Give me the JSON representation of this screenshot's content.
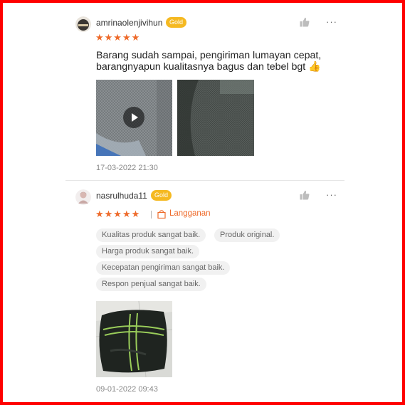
{
  "reviews": [
    {
      "username": "amrinaolenjivihun",
      "badge": "Gold",
      "stars": "★★★★★",
      "comment_line1": "Barang sudah sampai, pengiriman lumayan cepat,",
      "comment_line2": "barangnyapun kualitasnya bagus dan tebel bgt 👍",
      "date": "17-03-2022 21:30",
      "more": "···"
    },
    {
      "username": "nasrulhuda11",
      "badge": "Gold",
      "stars": "★★★★★",
      "subscription_label": "Langganan",
      "tags": [
        "Kualitas produk sangat baik.",
        "Produk original.",
        "Harga produk sangat baik.",
        "Kecepatan pengiriman sangat baik.",
        "Respon penjual sangat baik."
      ],
      "date": "09-01-2022 09:43",
      "more": "···"
    }
  ],
  "colors": {
    "frame": "#ff0000",
    "badge": "#f5b921",
    "star": "#ee6a2a"
  }
}
